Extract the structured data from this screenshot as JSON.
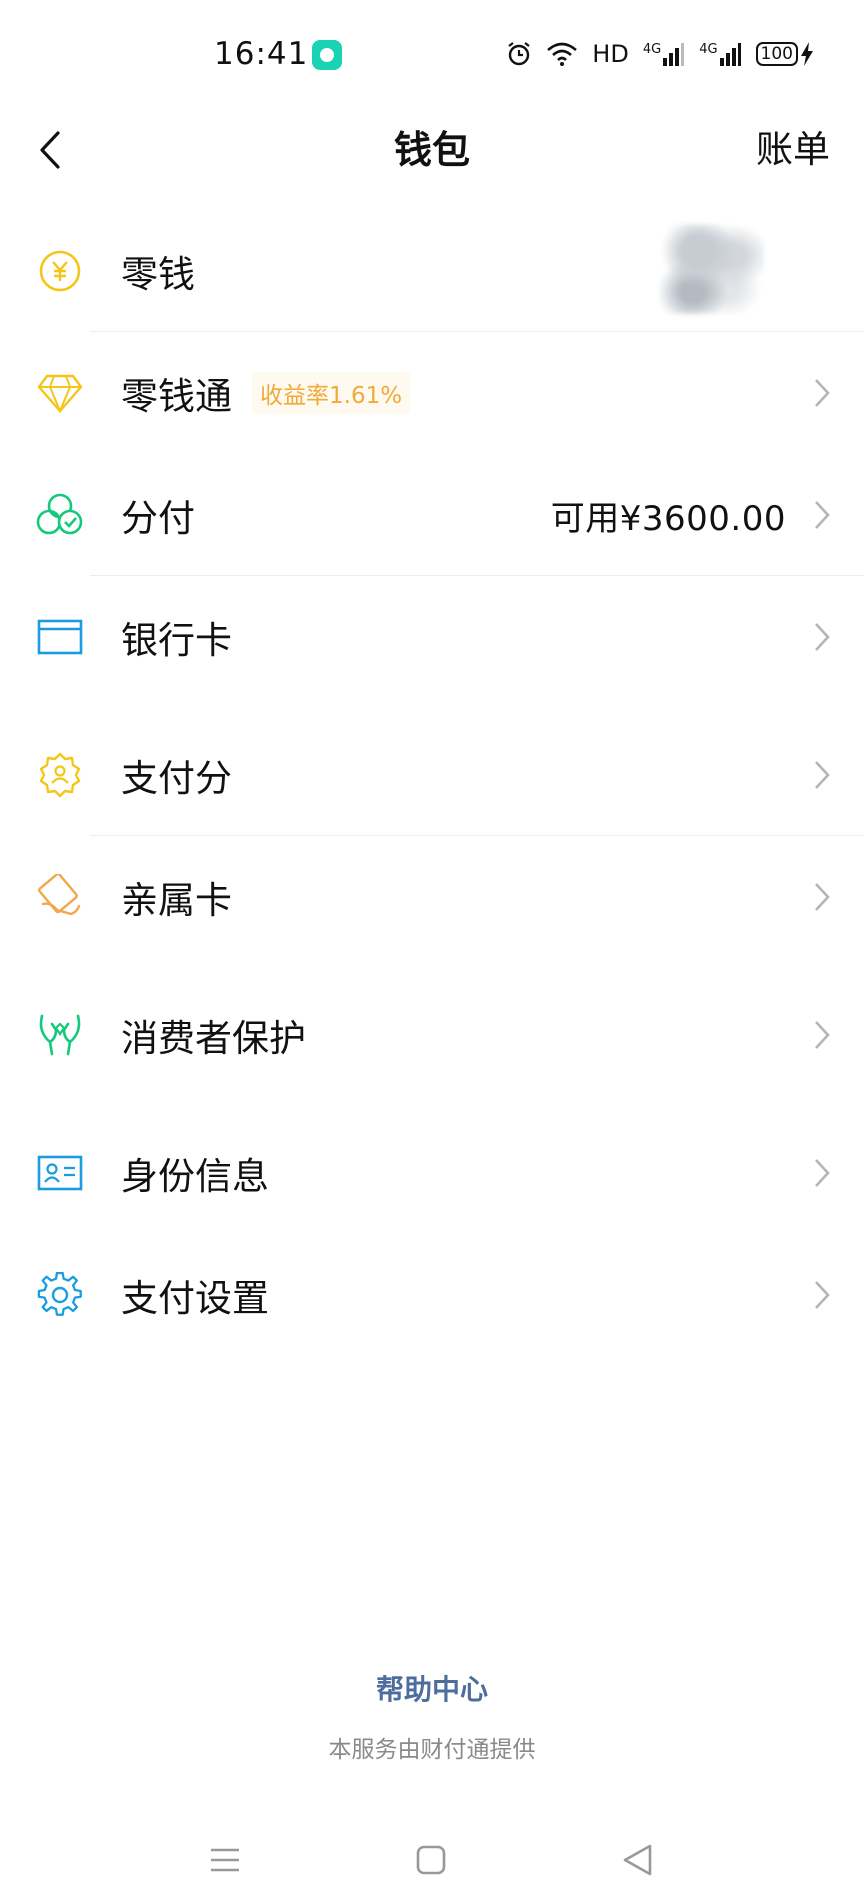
{
  "status": {
    "time": "16:41",
    "hd": "HD",
    "net1": "4G",
    "net2": "4G",
    "battery": "100"
  },
  "header": {
    "title": "钱包",
    "bill": "账单"
  },
  "items": [
    {
      "label": "零钱",
      "icon": "yuan-coin-icon",
      "color": "#f5c518"
    },
    {
      "label": "零钱通",
      "badge": "收益率1.61%",
      "icon": "diamond-icon",
      "color": "#f5c518"
    },
    {
      "label": "分付",
      "value": "可用¥3600.00",
      "icon": "fenfu-circles-icon",
      "color": "#14c97b"
    },
    {
      "label": "银行卡",
      "icon": "bank-card-icon",
      "color": "#1a9de0"
    },
    {
      "label": "支付分",
      "icon": "pay-score-badge-icon",
      "color": "#f5c518"
    },
    {
      "label": "亲属卡",
      "icon": "family-card-icon",
      "color": "#f3a64b"
    },
    {
      "label": "消费者保护",
      "icon": "protection-hands-icon",
      "color": "#14c97b"
    },
    {
      "label": "身份信息",
      "icon": "id-card-icon",
      "color": "#1a9de0"
    },
    {
      "label": "支付设置",
      "icon": "gear-icon",
      "color": "#1a9de0"
    }
  ],
  "footer": {
    "help": "帮助中心",
    "provider": "本服务由财付通提供"
  }
}
